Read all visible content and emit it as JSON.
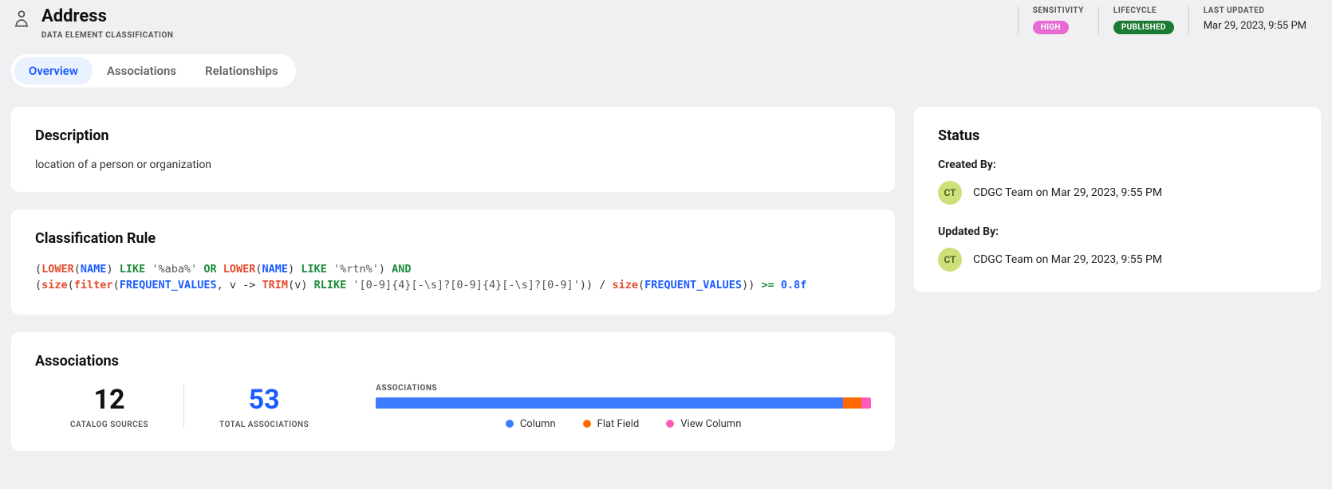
{
  "header": {
    "title": "Address",
    "subtitle": "DATA ELEMENT CLASSIFICATION"
  },
  "meta": {
    "sensitivity": {
      "label": "SENSITIVITY",
      "value": "HIGH"
    },
    "lifecycle": {
      "label": "LIFECYCLE",
      "value": "PUBLISHED"
    },
    "last_updated": {
      "label": "LAST UPDATED",
      "value": "Mar 29, 2023, 9:55 PM"
    }
  },
  "tabs": {
    "overview": "Overview",
    "associations": "Associations",
    "relationships": "Relationships"
  },
  "description": {
    "heading": "Description",
    "text": "location of a person or organization"
  },
  "rule": {
    "heading": "Classification Rule",
    "tokens": {
      "lparen1": "(",
      "lower1": "LOWER",
      "lparen2": "(",
      "name1": "NAME",
      "rparen1": ") ",
      "like1": "LIKE",
      "str1": " '%aba%' ",
      "or": "OR ",
      "lower2": "LOWER",
      "lparen3": "(",
      "name2": "NAME",
      "rparen2": ") ",
      "like2": "LIKE",
      "str2": " '%rtn%'",
      "rparen3": ") ",
      "and": "AND",
      "lparen4": "(",
      "size1": "size",
      "lparen5": "(",
      "filter": "filter",
      "lparen6": "(",
      "freq1": "FREQUENT_VALUES",
      "comma_lambda": ", v -> ",
      "trim": "TRIM",
      "v_paren": "(v) ",
      "rlike": "RLIKE",
      "regex": " '[0-9]{4}[-\\s]?[0-9]{4}[-\\s]?[0-9]'",
      "close12": ")) ",
      "slash": "/ ",
      "size2": "size",
      "lparen7": "(",
      "freq2": "FREQUENT_VALUES",
      "close2": ")) ",
      "gte": ">= ",
      "val": "0.8f"
    }
  },
  "status": {
    "heading": "Status",
    "created_label": "Created By:",
    "created_initials": "CT",
    "created_text": "CDGC Team on Mar 29, 2023, 9:55 PM",
    "updated_label": "Updated By:",
    "updated_initials": "CT",
    "updated_text": "CDGC Team on Mar 29, 2023, 9:55 PM"
  },
  "associations": {
    "heading": "Associations",
    "catalog_sources": {
      "value": "12",
      "label": "CATALOG SOURCES"
    },
    "total": {
      "value": "53",
      "label": "TOTAL ASSOCIATIONS"
    },
    "chart_label": "ASSOCIATIONS",
    "legend": {
      "column": "Column",
      "flat_field": "Flat Field",
      "view_column": "View Column"
    }
  },
  "chart_data": {
    "type": "bar",
    "title": "ASSOCIATIONS",
    "categories": [
      "Column",
      "Flat Field",
      "View Column"
    ],
    "values": [
      50,
      2,
      1
    ],
    "colors": [
      "#3d7bff",
      "#ff6a00",
      "#ff5bbd"
    ],
    "total": 53
  }
}
